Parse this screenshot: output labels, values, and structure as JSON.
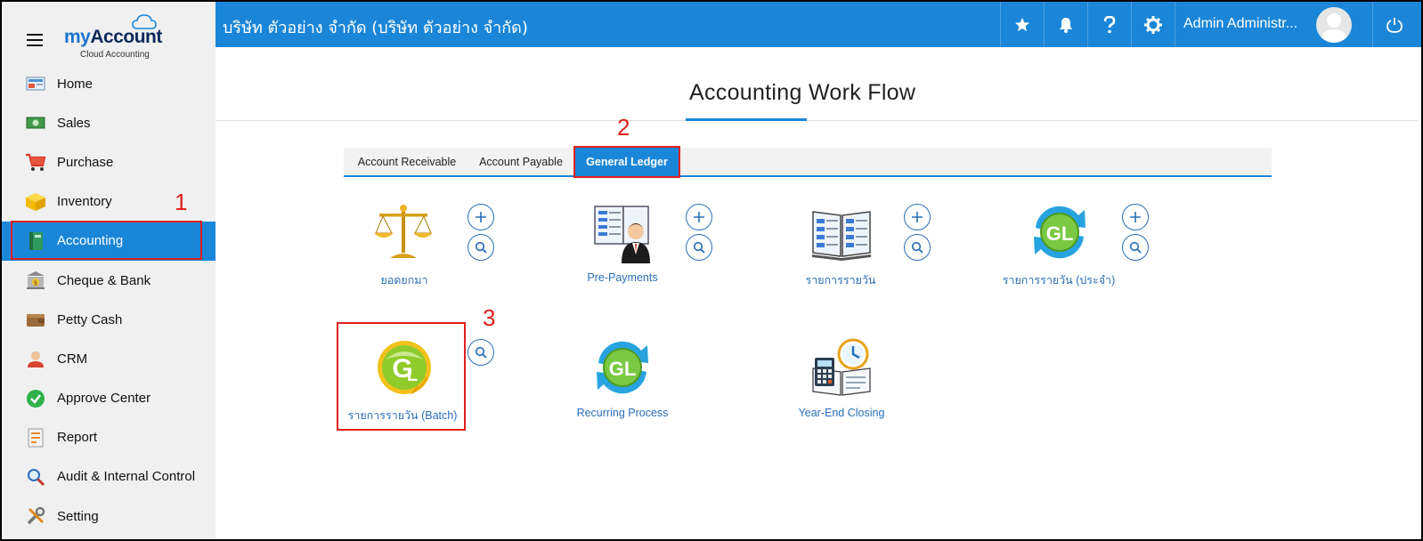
{
  "brand": {
    "logo_my": "my",
    "logo_account": "Account",
    "logo_sub": "Cloud Accounting"
  },
  "sidebar": {
    "items": [
      {
        "label": "Home",
        "icon": "home-icon"
      },
      {
        "label": "Sales",
        "icon": "sales-icon"
      },
      {
        "label": "Purchase",
        "icon": "cart-icon"
      },
      {
        "label": "Inventory",
        "icon": "box-icon"
      },
      {
        "label": "Accounting",
        "icon": "book-icon",
        "active": true
      },
      {
        "label": "Cheque & Bank",
        "icon": "bank-icon"
      },
      {
        "label": "Petty Cash",
        "icon": "wallet-icon"
      },
      {
        "label": "CRM",
        "icon": "person-icon"
      },
      {
        "label": "Approve Center",
        "icon": "check-icon"
      },
      {
        "label": "Report",
        "icon": "report-icon"
      },
      {
        "label": "Audit & Internal Control",
        "icon": "magnifier-icon"
      },
      {
        "label": "Setting",
        "icon": "tools-icon"
      }
    ]
  },
  "topbar": {
    "company": "บริษัท ตัวอย่าง จำกัด (บริษัท ตัวอย่าง จำกัด)",
    "user": "Admin Administr...",
    "icons": [
      "star-icon",
      "bell-icon",
      "help-icon",
      "gear-icon",
      "power-icon"
    ]
  },
  "main": {
    "title": "Accounting Work Flow",
    "tabs": [
      {
        "label": "Account Receivable"
      },
      {
        "label": "Account Payable"
      },
      {
        "label": "General Ledger",
        "active": true
      }
    ],
    "workflow": [
      {
        "label": "ยอดยกมา",
        "icon": "scale-icon"
      },
      {
        "label": "Pre-Payments",
        "icon": "prepayment-icon"
      },
      {
        "label": "รายการรายวัน",
        "icon": "journal-icon"
      },
      {
        "label": "รายการรายวัน (ประจำ)",
        "icon": "gl-recurring-icon"
      },
      {
        "label": "รายการรายวัน (Batch)",
        "icon": "gl-batch-icon"
      },
      {
        "label": "Recurring Process",
        "icon": "gl-process-icon"
      },
      {
        "label": "Year-End Closing",
        "icon": "year-end-icon"
      }
    ]
  },
  "annotations": {
    "one": "1",
    "two": "2",
    "three": "3"
  },
  "colors": {
    "primary": "#1b86d8",
    "annotation": "#e0201e",
    "link": "#2a6fb8"
  }
}
